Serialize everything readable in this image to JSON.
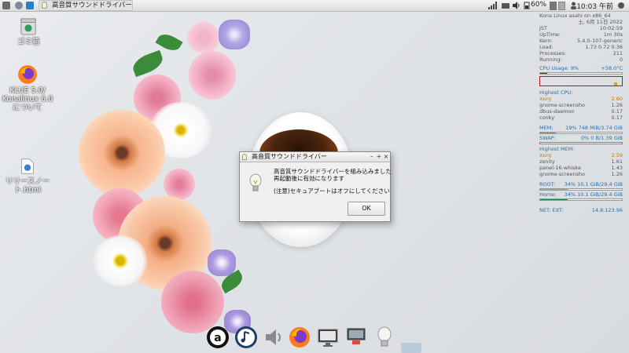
{
  "top_panel": {
    "task_button_label": "高音質サウンドドライバー",
    "battery": "60%",
    "clock": "10:03 午前"
  },
  "desktop_icons": [
    {
      "label": "ゴミ箱",
      "icon": "trash-icon"
    },
    {
      "label": "KLUE 5.0/ Konalinux 6.0について",
      "icon": "firefox-icon"
    },
    {
      "label": "リリースノート.html",
      "icon": "html-file-icon"
    }
  ],
  "conky": {
    "header": "Kona Linux asahi on x86_64",
    "lines": [
      [
        "",
        "土, 6月 11日 2022"
      ],
      [
        "JST",
        "10:02:59"
      ],
      [
        "UpTime:",
        "1m 30s"
      ],
      [
        "Kern:",
        "5.4.0-107-generic"
      ],
      [
        "Load:",
        "1.73 0.72 0.36"
      ],
      [
        "Processes:",
        "211"
      ],
      [
        "Running:",
        "0"
      ]
    ],
    "cpu_label": "CPU Usage: 9%",
    "cpu_temp": "+58.0°C",
    "cpu_percent": 9,
    "highest_cpu_title": "Highest CPU:",
    "highest_cpu": [
      {
        "name": "Xorg",
        "value": "2.60"
      },
      {
        "name": "gnome-screensho",
        "value": "1.26"
      },
      {
        "name": "dbus-daemon",
        "value": "0.17"
      },
      {
        "name": "conky",
        "value": "0.17"
      }
    ],
    "mem_label": "MEM:",
    "mem_value": "19% 748 MiB/3.74 GiB",
    "mem_percent": 19,
    "swap_label": "SWAP:",
    "swap_value": "0% 0 B/1.39 GiB",
    "swap_percent": 0,
    "highest_mem_title": "Highest MEM:",
    "highest_mem": [
      {
        "name": "Xorg",
        "value": "2.59"
      },
      {
        "name": "zenity",
        "value": "1.61"
      },
      {
        "name": "panel-16-whiske",
        "value": "1.43"
      },
      {
        "name": "gnome-screensho",
        "value": "1.26"
      }
    ],
    "root_label": "ROOT:",
    "root_value": "34% 10.1 GiB/29.4 GiB",
    "root_percent": 34,
    "home_label": "Home:",
    "home_value": "34% 10.1 GiB/29.4 GiB",
    "home_percent": 34,
    "net_label": "NET: EXT:",
    "net_value": "14.8.123.96"
  },
  "dialog": {
    "title": "高音質サウンドドライバー",
    "message_line1": "高音質サウンドドライバーを組み込みました",
    "message_line2": "再起動後に有効になります",
    "message_line3": "(注意)セキュアブートはオフにしてください",
    "ok_label": "OK"
  },
  "dock": [
    {
      "icon": "a-launcher-icon"
    },
    {
      "icon": "music-player-icon"
    },
    {
      "icon": "speaker-icon"
    },
    {
      "icon": "firefox-icon"
    },
    {
      "icon": "monitor-icon"
    },
    {
      "icon": "network-tool-icon"
    },
    {
      "icon": "bulb-icon"
    }
  ],
  "colors": {
    "cpu_bar": "#b01818",
    "mem_bar": "#2fb7d8",
    "swap_bar": "#d04cb0",
    "root_bar": "#e0a020",
    "home_bar": "#188838",
    "accent_header": "#2a6fa8"
  }
}
